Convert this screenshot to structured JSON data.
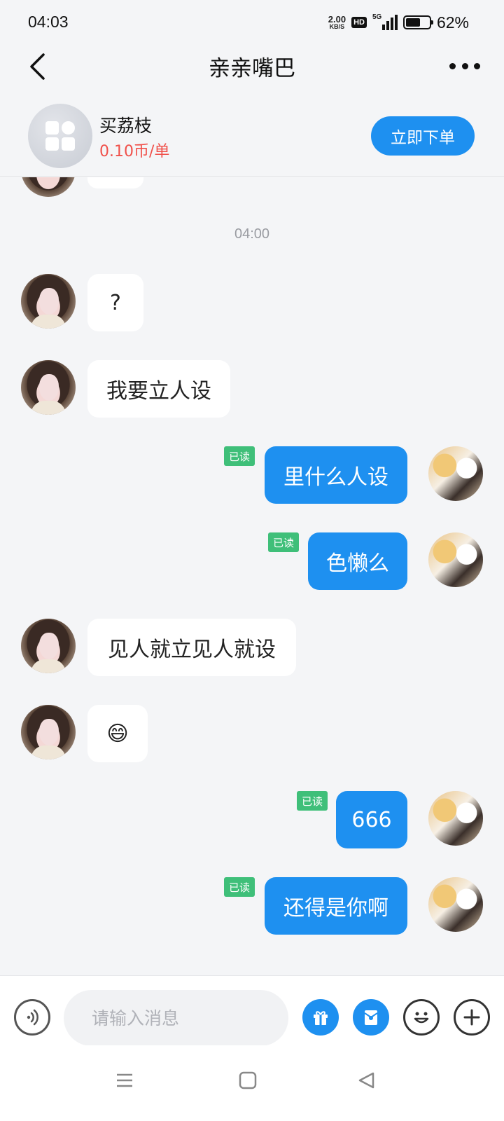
{
  "status_bar": {
    "time": "04:03",
    "net_speed": "2.00",
    "net_unit": "KB/S",
    "hd": "HD",
    "network": "5G",
    "battery_percent": "62%",
    "battery_level": 0.62
  },
  "header": {
    "title": "亲亲嘴巴"
  },
  "service": {
    "name": "买荔枝",
    "price": "0.10币/单",
    "order_label": "立即下单"
  },
  "chat": {
    "timestamp": "04:00",
    "read_label": "已读",
    "messages": [
      {
        "sender": "them",
        "text": "?"
      },
      {
        "sender": "them",
        "text": "我要立人设"
      },
      {
        "sender": "me",
        "text": "里什么人设",
        "read": true
      },
      {
        "sender": "me",
        "text": "色懒么",
        "read": true
      },
      {
        "sender": "them",
        "text": "见人就立见人就设"
      },
      {
        "sender": "them",
        "text": "😄"
      },
      {
        "sender": "me",
        "text": "666",
        "read": true
      },
      {
        "sender": "me",
        "text": "还得是你啊",
        "read": true
      }
    ]
  },
  "input_bar": {
    "placeholder": "请输入消息",
    "icons": [
      "voice-icon",
      "gift-icon",
      "red-packet-icon",
      "emoji-icon",
      "plus-icon"
    ]
  },
  "nav_bar": {
    "icons": [
      "menu-icon",
      "home-icon",
      "back-icon"
    ]
  },
  "colors": {
    "accent": "#1e90f0",
    "price": "#f0504a",
    "read_badge": "#3fbf79",
    "background": "#f4f5f7"
  }
}
